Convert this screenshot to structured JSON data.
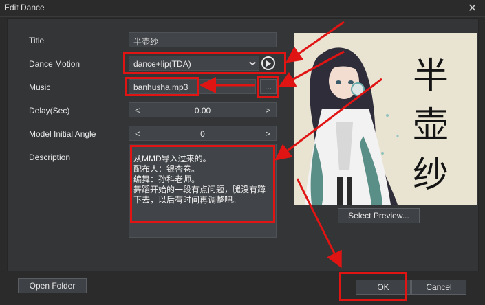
{
  "window": {
    "title": "Edit Dance",
    "close_glyph": "✕"
  },
  "form": {
    "title_label": "Title",
    "title_value": "半壶纱",
    "motion_label": "Dance Motion",
    "motion_value": "dance+lip(TDA)",
    "music_label": "Music",
    "music_value": "banhusha.mp3",
    "browse_label": "...",
    "delay_label": "Delay(Sec)",
    "delay_value": "0.00",
    "angle_label": "Model Initial Angle",
    "angle_value": "0",
    "description_label": "Description",
    "description_value": "从MMD导入过来的。\n配布人：银杏卷。\n编舞：孙科老师。\n舞蹈开始的一段有点问题，腿没有蹲\n下去，以后有时间再调整吧。",
    "decrement_glyph": "<",
    "increment_glyph": ">"
  },
  "preview": {
    "calligraphy": [
      "半",
      "壶",
      "纱"
    ],
    "select_button": "Select Preview..."
  },
  "footer": {
    "open_folder": "Open Folder",
    "ok": "OK",
    "cancel": "Cancel"
  },
  "icons": {
    "combo_arrow": "chevron-down-icon",
    "play": "play-circle-icon",
    "close": "close-icon"
  },
  "colors": {
    "annotation_red": "#e11414",
    "panel_bg": "#333537",
    "field_bg": "#414448"
  }
}
